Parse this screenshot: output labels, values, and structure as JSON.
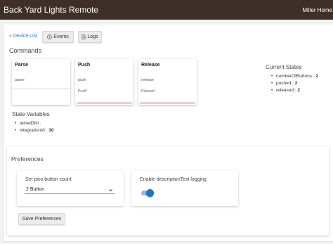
{
  "header": {
    "title": "Back Yard Lights Remote",
    "hub_name": "Miller Home"
  },
  "nav": {
    "device_list": "« Device List",
    "events_label": "Events",
    "logs_label": "Logs"
  },
  "commands": {
    "title": "Commands",
    "items": [
      {
        "name": "Parse",
        "desc": "parse",
        "param": ""
      },
      {
        "name": "Push",
        "desc": "push",
        "param": "Push*"
      },
      {
        "name": "Release",
        "desc": "release",
        "param": "Release*"
      }
    ]
  },
  "current_states": {
    "title": "Current States",
    "items": [
      {
        "key": "numberOfButtons :",
        "value": "2"
      },
      {
        "key": "pushed :",
        "value": "2"
      },
      {
        "key": "released :",
        "value": "2"
      }
    ]
  },
  "state_variables": {
    "title": "State Variables",
    "items": [
      {
        "key": "telnetDNI :",
        "value": ""
      },
      {
        "key": "integrationId :",
        "value": "30"
      }
    ]
  },
  "preferences": {
    "title": "Preferences",
    "pico_label": "Set pico button count",
    "pico_value": "2 Button",
    "logging_label": "Enable descriptionText logging",
    "logging_enabled": true,
    "save_label": "Save Preferences"
  },
  "colors": {
    "header_bg": "#3e2f28",
    "accent": "#1a73c8",
    "invalid_underline": "#d23a3a"
  },
  "icons": {
    "events": "info-circle-icon",
    "logs": "document-icon",
    "select": "chevron-down-icon"
  }
}
